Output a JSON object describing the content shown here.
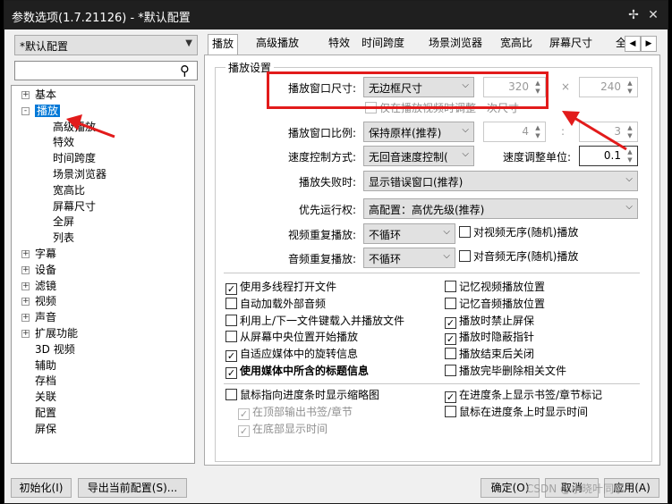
{
  "window": {
    "title": "参数选项(1.7.21126) - *默认配置",
    "pin_icon": "pin-icon",
    "close_icon": "close-icon"
  },
  "preset": {
    "selected": "*默认配置"
  },
  "search": {
    "value": "",
    "icon": "search-icon"
  },
  "tree": [
    {
      "label": "基本",
      "expander": "+"
    },
    {
      "label": "播放",
      "expander": "-"
    },
    {
      "label": "高级播放"
    },
    {
      "label": "特效"
    },
    {
      "label": "时间跨度"
    },
    {
      "label": "场景浏览器"
    },
    {
      "label": "宽高比"
    },
    {
      "label": "屏幕尺寸"
    },
    {
      "label": "全屏"
    },
    {
      "label": "列表"
    },
    {
      "label": "字幕",
      "expander": "+"
    },
    {
      "label": "设备",
      "expander": "+"
    },
    {
      "label": "滤镜",
      "expander": "+"
    },
    {
      "label": "视频",
      "expander": "+"
    },
    {
      "label": "声音",
      "expander": "+"
    },
    {
      "label": "扩展功能",
      "expander": "+"
    },
    {
      "label": "3D 视频"
    },
    {
      "label": "辅助"
    },
    {
      "label": "存档"
    },
    {
      "label": "关联"
    },
    {
      "label": "配置"
    },
    {
      "label": "屏保"
    }
  ],
  "tabs": [
    "播放",
    "高级播放",
    "特效",
    "时间跨度",
    "场景浏览器",
    "宽高比",
    "屏幕尺寸",
    "全"
  ],
  "tab_scroll": {
    "left": "◀",
    "right": "▶"
  },
  "group_title": "播放设置",
  "settings": {
    "window_size_label": "播放窗口尺寸:",
    "window_size_value": "无边框尺寸",
    "width_value": "320",
    "times": "×",
    "height_value": "240",
    "resize_video_only": "仅在播放视频时调整一次尺寸",
    "ratio_label": "播放窗口比例:",
    "ratio_value": "保持原样(推荐)",
    "ratio_a": "4",
    "ratio_b": "3",
    "speed_label": "速度控制方式:",
    "speed_value": "无回音速度控制(",
    "speed_unit_label": "速度调整单位:",
    "speed_unit_value": "0.1",
    "fail_label": "播放失败时:",
    "fail_value": "显示错误窗口(推荐)",
    "priority_label": "优先运行权:",
    "priority_value": "高配置：高优先级(推荐)",
    "video_repeat_label": "视频重复播放:",
    "video_repeat_value": "不循环",
    "video_shuffle": "对视频无序(随机)播放",
    "audio_repeat_label": "音频重复播放:",
    "audio_repeat_value": "不循环",
    "audio_shuffle": "对音频无序(随机)播放"
  },
  "checks_left": [
    {
      "label": "使用多线程打开文件",
      "checked": true
    },
    {
      "label": "自动加载外部音频",
      "checked": false
    },
    {
      "label": "利用上/下一文件键载入并播放文件",
      "checked": false
    },
    {
      "label": "从屏幕中央位置开始播放",
      "checked": false
    },
    {
      "label": "自适应媒体中的旋转信息",
      "checked": true
    },
    {
      "label": "使用媒体中所含的标题信息",
      "checked": true,
      "bold": true
    }
  ],
  "checks_right": [
    {
      "label": "记忆视频播放位置",
      "checked": false
    },
    {
      "label": "记忆音频播放位置",
      "checked": false
    },
    {
      "label": "播放时禁止屏保",
      "checked": true
    },
    {
      "label": "播放时隐蔽指针",
      "checked": true
    },
    {
      "label": "播放结束后关闭",
      "checked": false
    },
    {
      "label": "播放完毕删除相关文件",
      "checked": false
    }
  ],
  "seek": {
    "thumb": "鼠标指向进度条时显示缩略图",
    "top_chapter": "在顶部输出书签/章节",
    "bottom_time": "在底部显示时间",
    "bookmarks": "在进度条上显示书签/章节标记",
    "hover_time": "鼠标在进度条上时显示时间"
  },
  "footer": {
    "reset": "初始化(I)",
    "export": "导出当前配置(S)...",
    "confirm": "确定(O)",
    "cancel": "取消",
    "apply": "应用(A)"
  },
  "watermark": "CSDN @小晓叶同学",
  "colors": {
    "annotation": "#e21b1b",
    "titlebar": "#1f1f1f",
    "selection": "#0078d7"
  }
}
